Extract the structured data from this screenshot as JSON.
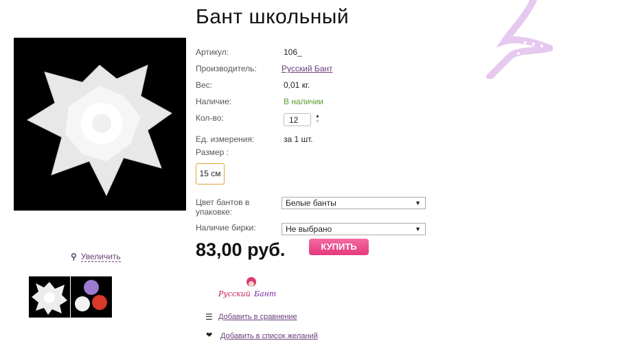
{
  "product": {
    "title": "Бант школьный",
    "price": "83,00 руб.",
    "buy_label": "КУПИТЬ",
    "zoom_label": "Увеличить"
  },
  "details": {
    "article_label": "Артикул:",
    "article_value": "106_",
    "maker_label": "Производитель:",
    "maker_value": "Русский Бант",
    "weight_label": "Вес:",
    "weight_value": "0,01 кг.",
    "stock_label": "Наличие:",
    "stock_value": "В наличии",
    "qty_label": "Кол-во:",
    "qty_value": "12",
    "unit_label": "Ед. измерения:",
    "unit_value": "за 1 шт.",
    "size_label": "Размер :",
    "size_option": "15 см",
    "color_label": "Цвет бантов в упаковке:",
    "color_value": "Белые банты",
    "tag_label": "Наличие бирки:",
    "tag_value": "Не выбрано"
  },
  "brand": {
    "logo_text": "Русский Бант"
  },
  "actions": {
    "compare": "Добавить в сравнение",
    "wishlist": "Добавить в список желаний"
  },
  "colors": {
    "accent": "#e4397d",
    "link": "#6a3d7a",
    "stock": "#5a9a2a",
    "size_border": "#e2a23a"
  }
}
